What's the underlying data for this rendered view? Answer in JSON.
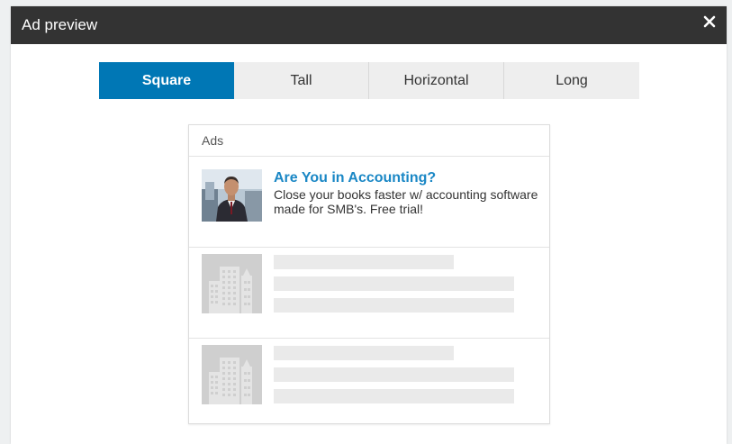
{
  "modal": {
    "title": "Ad preview",
    "close_icon": "close-icon"
  },
  "tabs": [
    {
      "label": "Square",
      "active": true
    },
    {
      "label": "Tall",
      "active": false
    },
    {
      "label": "Horizontal",
      "active": false
    },
    {
      "label": "Long",
      "active": false
    }
  ],
  "preview": {
    "section_label": "Ads",
    "ad": {
      "headline": "Are You in Accounting?",
      "body": "Close your books faster w/ accounting software made for SMB's. Free trial!",
      "image_icon": "person-photo"
    },
    "placeholders": [
      {
        "icon": "building-icon"
      },
      {
        "icon": "building-icon"
      }
    ]
  },
  "colors": {
    "header_bg": "#333333",
    "active_tab": "#0077b5",
    "inactive_tab": "#eeeeee",
    "headline": "#1a87c5"
  }
}
